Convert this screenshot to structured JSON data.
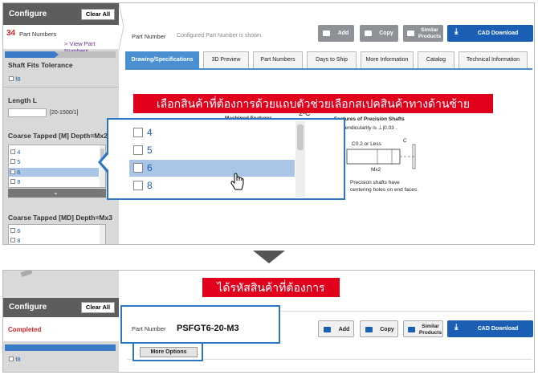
{
  "step1": {
    "sidebar": {
      "title": "Configure",
      "clear_all": "Clear All",
      "count": "34",
      "count_label": "Part Numbers",
      "view_link": "> View Part Numbers",
      "shaft_fits": "Shaft Fits Tolerance",
      "f8_option": "f8",
      "length_title": "Length L",
      "length_range": "[20-1500/1]",
      "coarse_title": "Coarse Tapped [M] Depth=Mx2",
      "coarse_options": [
        "4",
        "5",
        "6",
        "8"
      ],
      "coarse_md_title": "Coarse Tapped [MD] Depth=Mx3",
      "coarse_md_options": [
        "6",
        "8"
      ]
    },
    "toolbar": {
      "part_number_label": "Part Number",
      "part_number_hint": "Configured Part Number is shown.",
      "add": "Add",
      "copy": "Copy",
      "similar_line1": "Similar",
      "similar_line2": "Products",
      "cad": "CAD Download"
    },
    "tabs": [
      "Drawing/Specifications",
      "3D Preview",
      "Part Numbers",
      "Days to Ship",
      "More Information",
      "Catalog",
      "Technical Information"
    ],
    "banner": "เลือกสินค้าที่ต้องการด้วยแถบตัวช่วยเลือกสเปคสินค้าทางด้านซ้าย",
    "drawing": {
      "machined_features": "Machined Features",
      "precision_title": "Features of Precision Shafts",
      "perpendicularity": "pendicularity is ⊥|0.03 .",
      "chamfer": "C0.2 or Less",
      "c_label": "C",
      "mx2": "Mx2",
      "note1": "Precision shafts have",
      "note2": "centering holes on end faces.",
      "dim": "2-C"
    },
    "zoom_list": [
      "4",
      "5",
      "6",
      "8"
    ],
    "zoom_selected": "6"
  },
  "step2": {
    "banner": "ได้รหัสสินค้าที่ต้องการ",
    "sidebar": {
      "title": "Configure",
      "clear_all": "Clear All",
      "completed": "Completed",
      "f8_option": "f8"
    },
    "part_number_label": "Part Number",
    "part_number_value": "PSFGT6-20-M3",
    "more_options": "More Options",
    "add": "Add",
    "copy": "Copy",
    "similar_line1": "Similar",
    "similar_line2": "Products",
    "cad": "CAD Download"
  },
  "colors": {
    "accent_blue": "#2a78c4",
    "banner_red": "#e0001b",
    "tab_active": "#4a8fd0",
    "cad_button": "#1a5fb4",
    "count_red": "#d3242b"
  }
}
